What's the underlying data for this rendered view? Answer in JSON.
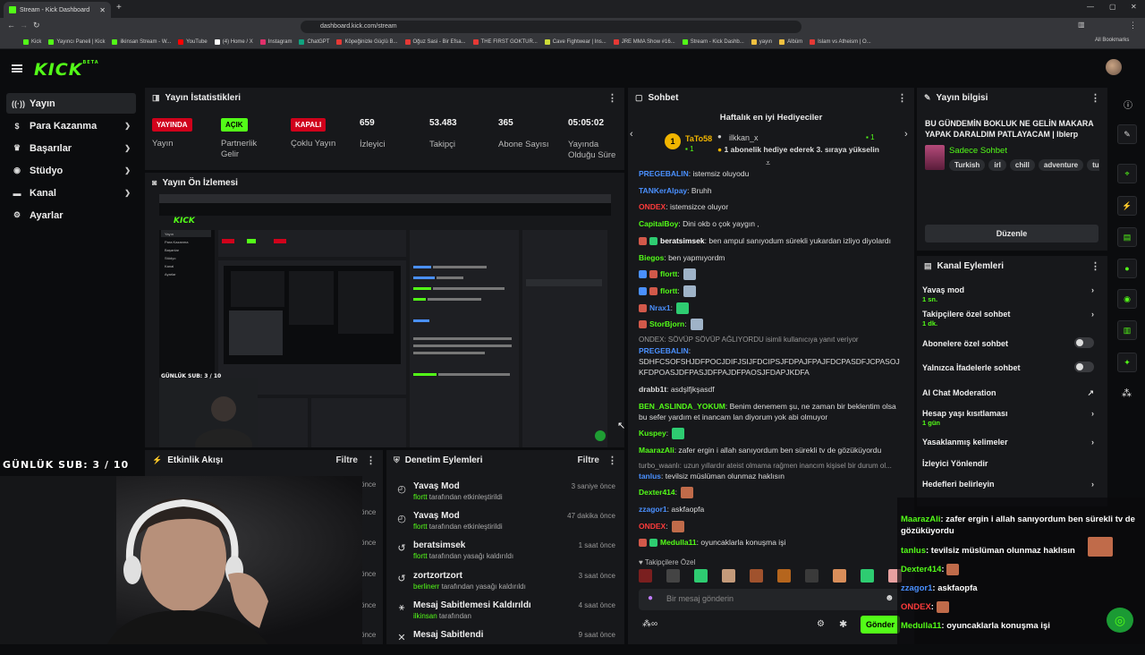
{
  "browser": {
    "tab_title": "Stream - Kick Dashboard",
    "url": "dashboard.kick.com/stream",
    "bookmarks": [
      "Kick",
      "Yayıncı Paneli | Kick",
      "ilkinsan Stream - W...",
      "YouTube",
      "(4) Home / X",
      "Instagram",
      "ChatGPT",
      "Köpeğinizle Güçlü B...",
      "Oğuz Sasi - Bir Efsa...",
      "THE FIRST GOKTUR...",
      "Cave Fightwear | Ins...",
      "JRE MMA Show #16...",
      "Stream - Kick Dashb...",
      "yayın",
      "Albüm",
      "Islam vs Atheism | O..."
    ],
    "all_bookmarks": "All Bookmarks",
    "bookmark_colors": [
      "#53fc18",
      "#53fc18",
      "#53fc18",
      "#ff0000",
      "#ffffff",
      "#e1306c",
      "#10a37f",
      "#e53935",
      "#e53935",
      "#e53935",
      "#cddc39",
      "#e53935",
      "#53fc18",
      "#f0c040",
      "#f0c040",
      "#e53935"
    ]
  },
  "brand": {
    "logo": "KICK",
    "logo_sup": "BETA",
    "accent": "#53fc18"
  },
  "sidebar": {
    "items": [
      {
        "label": "Yayın",
        "icon": "stream-icon",
        "glyph": "((·))"
      },
      {
        "label": "Para Kazanma",
        "icon": "money-icon",
        "glyph": "$"
      },
      {
        "label": "Başarılar",
        "icon": "trophy-icon",
        "glyph": "♛"
      },
      {
        "label": "Stüdyo",
        "icon": "studio-icon",
        "glyph": "◉"
      },
      {
        "label": "Kanal",
        "icon": "channel-icon",
        "glyph": "▬"
      },
      {
        "label": "Ayarlar",
        "icon": "settings-icon",
        "glyph": "⚙"
      }
    ]
  },
  "stats": {
    "title": "Yayın İstatistikleri",
    "items": [
      {
        "badge": "YAYINDA",
        "label": "Yayın"
      },
      {
        "badge": "AÇIK",
        "label": "Partnerlik Gelir Programı"
      },
      {
        "badge": "KAPALI",
        "label": "Çoklu Yayın"
      },
      {
        "value": "659",
        "label": "İzleyici"
      },
      {
        "value": "53.483",
        "label": "Takipçi"
      },
      {
        "value": "365",
        "label": "Abone Sayısı"
      },
      {
        "value": "05:05:02",
        "label": "Yayında Olduğu Süre"
      }
    ]
  },
  "preview": {
    "title": "Yayın Ön İzlemesi"
  },
  "overlay_text": "GÜNLÜK SUB: 3 / 10",
  "activity": {
    "title": "Etkinlik Akışı",
    "filter": "Filtre",
    "times": [
      "önce",
      "önce",
      "önce",
      "önce",
      "önce",
      "önce"
    ]
  },
  "moderation": {
    "title": "Denetim Eylemleri",
    "filter": "Filtre",
    "items": [
      {
        "title": "Yavaş Mod",
        "user": "flortt",
        "text": "tarafından etkinleştirildi",
        "time": "3 saniye önce"
      },
      {
        "title": "Yavaş Mod",
        "user": "flortt",
        "text": "tarafından etkinleştirildi",
        "time": "47 dakika önce"
      },
      {
        "title": "beratsimsek",
        "user": "flortt",
        "text": "tarafından yasağı kaldırıldı",
        "time": "1 saat önce"
      },
      {
        "title": "zortzortzort",
        "user": "berlinerr",
        "text": "tarafından yasağı kaldırıldı",
        "time": "3 saat önce"
      },
      {
        "title": "Mesaj Sabitlemesi Kaldırıldı",
        "user": "ilkinsan",
        "text": "tarafından",
        "time": "4 saat önce"
      },
      {
        "title": "Mesaj Sabitlendi",
        "user": "",
        "text": "",
        "time": "9 saat önce"
      }
    ]
  },
  "chat": {
    "title": "Sohbet",
    "gifters_title": "Haftalık en iyi Hediyeciler",
    "gifter1_name": "TaTo58",
    "gifter1_count": "1",
    "gifter2_name": "ilkkan_x",
    "gifter2_count": "1",
    "gifter_notice": "1 abonelik hediye ederek 3. sıraya yükselin",
    "messages": [
      {
        "user": "PREGEBALIN",
        "color": "#4a90ff",
        "text": "istemsiz oluyodu"
      },
      {
        "user": "TANKerAlpay",
        "color": "#4a90ff",
        "text": "Bruhh"
      },
      {
        "user": "ONDEX",
        "color": "#ff3b3b",
        "text": "istemsizce oluyor"
      },
      {
        "user": "CapitalBoy",
        "color": "#53fc18",
        "text": "Dini okb o çok yaygın ,"
      },
      {
        "user": "beratsimsek",
        "color": "#ffffff",
        "text": "ben ampul sanıyodum sürekli yukardan izliyo diyolardı"
      },
      {
        "user": "Biegos",
        "color": "#53fc18",
        "text": "ben yapmıyordm"
      },
      {
        "user": "flortt",
        "color": "#53fc18",
        "text": ""
      },
      {
        "user": "flortt",
        "color": "#53fc18",
        "text": ""
      },
      {
        "user": "Nrax1",
        "color": "#4a90ff",
        "text": ""
      },
      {
        "user": "StorBjorn",
        "color": "#53fc18",
        "text": ""
      }
    ],
    "reply_note": "ONDEX: SÖVÜP SÖVÜP AĞLIYORDU isimli kullanıcıya yanıt veriyor",
    "long_user": "PREGEBALIN",
    "long_text": "SDHFCSOFSHJDFPOCJDIFJSIJFDCIPSJFDPAJFPAJFDCPASDFJCPASOJKFDPOASJDFPASJDFPAJDFPAOSJFDAPJKDFA",
    "m_drabb_user": "drabb1t",
    "m_drabb_text": "asdşlfjkşasdf",
    "m_ben_user": "BEN_ASLINDA_YOKUM",
    "m_ben_text": "Benim denemem şu, ne zaman bir beklentim olsa bu sefer yardım et inancam lan diyorum yok abi olmuyor",
    "m_kuspey_user": "Kuspey",
    "m_maaraz_user": "MaarazAli",
    "m_maaraz_text": "zafer ergin i allah sanıyordum ben sürekli tv de gözüküyordu",
    "reply2": "turbo_waanlı: uzun yıllardır ateist olmama rağmen inancım kişisel bir durum ol...",
    "m_tanlus_user": "tanlus",
    "m_tanlus_text": "tevilsiz müslüman olunmaz haklısın",
    "m_dexter_user": "Dexter414",
    "m_zzagor_user": "zzagor1",
    "m_zzagor_text": "askfaopfa",
    "m_ondex_user": "ONDEX",
    "m_medulla_user": "Medulla11",
    "m_medulla_text": "oyuncaklarla konuşma işi",
    "followers_only": "Takipçilere Özel",
    "input_placeholder": "Bir mesaj gönderin",
    "send": "Gönder"
  },
  "stream_info": {
    "title": "Yayın bilgisi",
    "stream_title": "BU GÜNDEMİN BOKLUK NE GELİN MAKARA YAPAK DARALDIM PATLAYACAM | Iblerp",
    "category": "Sadece Sohbet",
    "tags": [
      "Turkish",
      "irl",
      "chill",
      "adventure",
      "turki"
    ],
    "edit": "Düzenle"
  },
  "channel_actions": {
    "title": "Kanal Eylemleri",
    "slow_mode": "Yavaş mod",
    "slow_mode_val": "1 sn.",
    "followers_chat": "Takipçilere özel sohbet",
    "followers_chat_val": "1 dk.",
    "subs_chat": "Abonelere özel sohbet",
    "emote_chat": "Yalnızca İfadelerle sohbet",
    "ai_mod": "AI Chat Moderation",
    "account_age": "Hesap yaşı kısıtlaması",
    "account_age_val": "1 gün",
    "banned_words": "Yasaklanmış kelimeler",
    "redirect": "İzleyici Yönlendir",
    "goals": "Hedefleri belirleyin"
  },
  "overlay_chat": [
    {
      "user": "MaarazAli",
      "text": "zafer ergin i allah sanıyordum ben sürekli tv de gözüküyordu",
      "color": "#53fc18"
    },
    {
      "user": "tanlus",
      "text": "tevilsiz müslüman olunmaz haklısın",
      "color": "#53fc18"
    },
    {
      "user": "Dexter414",
      "text": "",
      "color": "#53fc18"
    },
    {
      "user": "zzagor1",
      "text": "askfaopfa",
      "color": "#4a90ff"
    },
    {
      "user": "ONDEX",
      "text": "",
      "color": "#ff3b3b"
    },
    {
      "user": "Medulla11",
      "text": "oyuncaklarla konuşma işi",
      "color": "#53fc18"
    }
  ]
}
